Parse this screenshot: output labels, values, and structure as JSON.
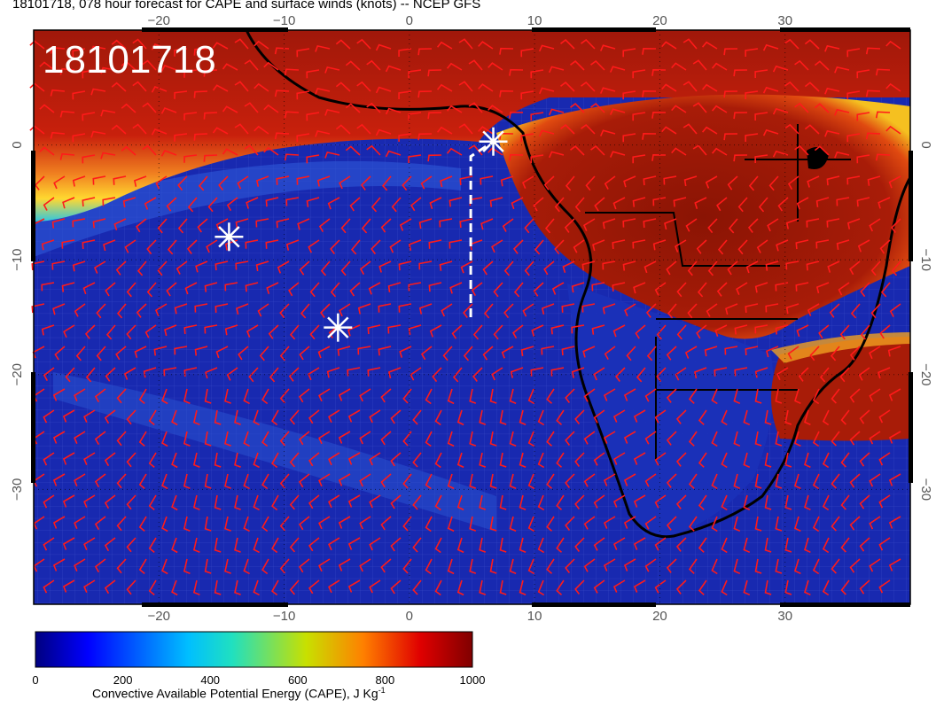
{
  "title": "18101718, 078 hour forecast for CAPE and surface winds (knots) -- NCEP GFS",
  "overlay_label": "18101718",
  "map": {
    "projection": "lat-lon",
    "lon_range": [
      -30,
      40
    ],
    "lat_range": [
      -40,
      10
    ],
    "lon_ticks": [
      -20,
      -10,
      0,
      10,
      20,
      30
    ],
    "lat_ticks": [
      0,
      -10,
      -20,
      -30
    ],
    "lon_tick_labels": [
      "−20",
      "−10",
      "0",
      "10",
      "20",
      "30"
    ],
    "lat_tick_labels": [
      "0",
      "−10",
      "−20",
      "−30"
    ],
    "markers": [
      {
        "name": "asterisk-marker",
        "lon": -14.4,
        "lat": -8.0
      },
      {
        "name": "asterisk-marker",
        "lon": -5.7,
        "lat": -15.9
      },
      {
        "name": "asterisk-marker",
        "lon": 6.7,
        "lat": 0.3
      }
    ],
    "dashed_track": [
      [
        4.9,
        -15.0
      ],
      [
        4.9,
        -1.0
      ],
      [
        6.7,
        0.3
      ]
    ],
    "colors": {
      "ocean_cape": "#1226b8",
      "high_cape": "#9a1a05",
      "wind_barbs": "#ff1a1a",
      "coastline": "#000000"
    }
  },
  "colorbar": {
    "min": 0,
    "max": 1000,
    "tick_labels": [
      "0",
      "200",
      "400",
      "600",
      "800",
      "1000"
    ],
    "title": "Convective Available Potential Energy (CAPE), J Kg",
    "title_superscript": "-1",
    "colormap": "jet"
  }
}
